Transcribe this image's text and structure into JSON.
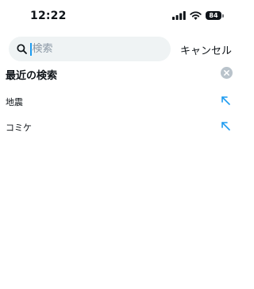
{
  "status_bar": {
    "time": "12:22",
    "battery": "84",
    "icons": [
      "signal-icon",
      "wifi-icon",
      "battery-icon"
    ]
  },
  "search": {
    "value": "",
    "placeholder": "検索",
    "cancel_label": "キャンセル"
  },
  "recent": {
    "title": "最近の検索",
    "clear_icon": "close-circle-icon",
    "items": [
      {
        "label": "地震",
        "icon": "fill-arrow-icon"
      },
      {
        "label": "コミケ",
        "icon": "fill-arrow-icon"
      }
    ]
  },
  "colors": {
    "accent": "#1d9bf0",
    "search_bg": "#eff3f4",
    "text": "#0f1419",
    "placeholder": "#8b98a5",
    "clear_bg": "#b9c3cb"
  }
}
